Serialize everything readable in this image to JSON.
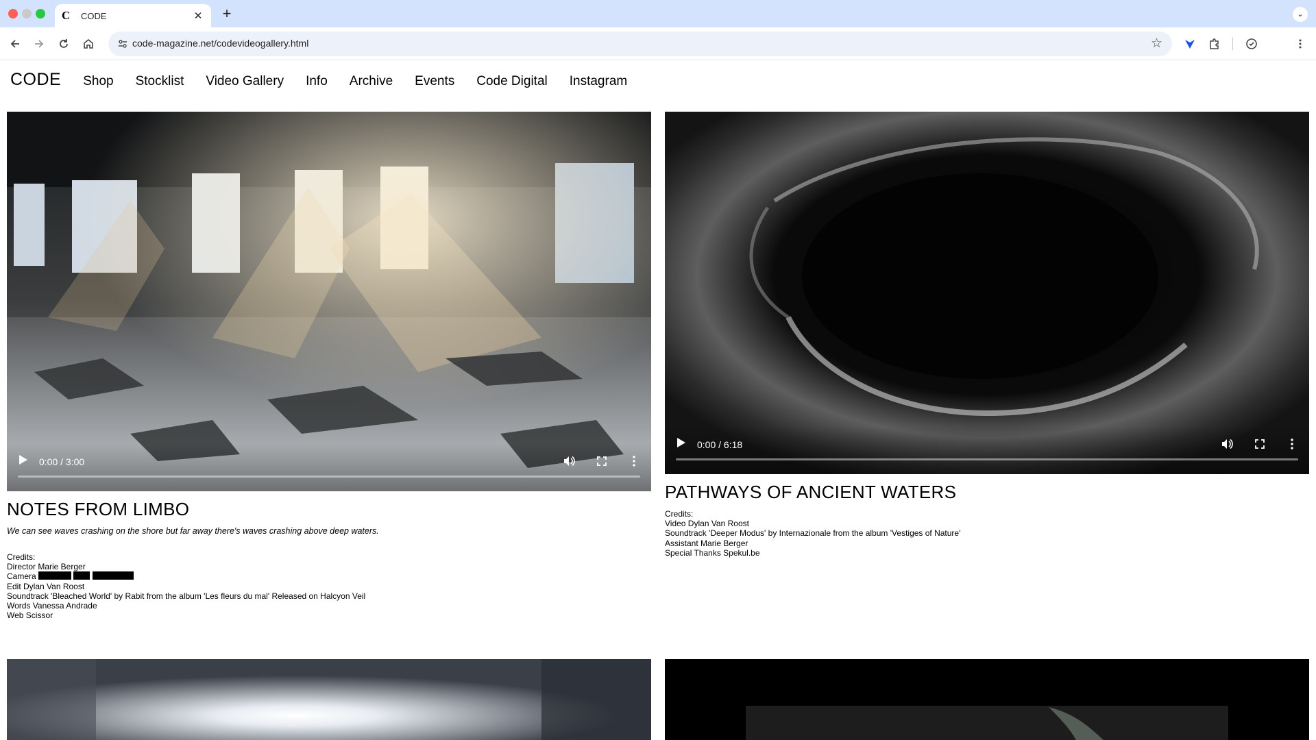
{
  "browser": {
    "tab": {
      "title": "CODE",
      "favicon_letter": "C"
    },
    "new_tab_symbol": "+",
    "url": "code-magazine.net/codevideogallery.html",
    "icons": [
      "back-icon",
      "forward-icon",
      "reload-icon",
      "home-icon",
      "site-info-icon",
      "bookmark-star-icon",
      "extension-icon",
      "puzzle-icon",
      "profile-icon",
      "menu-icon"
    ]
  },
  "nav": {
    "logo": "CODE",
    "items": [
      "Shop",
      "Stocklist",
      "Video Gallery",
      "Info",
      "Archive",
      "Events",
      "Code Digital",
      "Instagram"
    ]
  },
  "videos": [
    {
      "time": "0:00 / 3:00",
      "progress": 0,
      "title": "NOTES FROM LIMBO",
      "description": "We can see waves crashing on the shore but far away there's waves crashing above deep waters.",
      "credits_label": "Credits:",
      "credits": [
        "Director Marie Berger",
        "Camera",
        "Edit Dylan Van Roost",
        "Soundtrack 'Bleached World' by Rabit from the album 'Les fleurs du mal' Released on Halcyon Veil",
        "Words Vanessa Andrade",
        "Web Scissor"
      ]
    },
    {
      "time": "0:00 / 6:18",
      "progress": 0,
      "title": "PATHWAYS OF ANCIENT WATERS",
      "credits_label": "Credits:",
      "credits": [
        "Video Dylan Van Roost",
        "Soundtrack 'Deeper Modus' by Internazionale from the album 'Vestiges of Nature'",
        "Assistant Marie Berger",
        "Special Thanks Spekul.be"
      ]
    }
  ]
}
